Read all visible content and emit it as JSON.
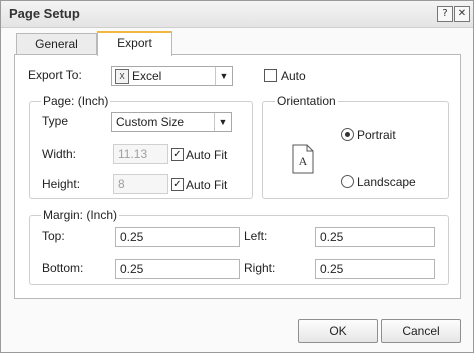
{
  "dialog": {
    "title": "Page Setup",
    "help_label": "?",
    "close_label": "✕"
  },
  "tabs": [
    {
      "label": "General"
    },
    {
      "label": "Export"
    }
  ],
  "export": {
    "export_to_label": "Export To:",
    "format_value": "Excel",
    "format_icon": "excel-icon",
    "auto_label": "Auto",
    "auto_checked": false
  },
  "page": {
    "group_label": "Page: (Inch)",
    "type_label": "Type",
    "type_value": "Custom Size",
    "width_label": "Width:",
    "width_value": "11.13",
    "height_label": "Height:",
    "height_value": "8",
    "auto_fit_label": "Auto Fit",
    "width_auto_fit_checked": true,
    "height_auto_fit_checked": true
  },
  "orientation": {
    "group_label": "Orientation",
    "portrait_label": "Portrait",
    "landscape_label": "Landscape",
    "selected": "Portrait",
    "page_icon_letter": "A"
  },
  "margin": {
    "group_label": "Margin: (Inch)",
    "top_label": "Top:",
    "top_value": "0.25",
    "left_label": "Left:",
    "left_value": "0.25",
    "bottom_label": "Bottom:",
    "bottom_value": "0.25",
    "right_label": "Right:",
    "right_value": "0.25"
  },
  "buttons": {
    "ok_label": "OK",
    "cancel_label": "Cancel"
  },
  "colors": {
    "active_tab_accent": "#f0b840"
  }
}
